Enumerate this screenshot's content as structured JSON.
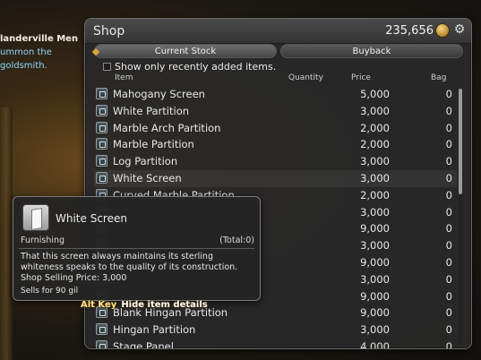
{
  "background": {
    "chat_line1": "landerville Men",
    "chat_line2": "ummon the goldsmith."
  },
  "shop": {
    "title": "Shop",
    "gil_amount": "235,656",
    "tabs": [
      {
        "label": "Current Stock",
        "active": true
      },
      {
        "label": "Buyback",
        "active": false
      }
    ],
    "filter_label": "Show only recently added items.",
    "filter_checked": false,
    "columns": {
      "item": "Item",
      "quantity": "Quantity",
      "price": "Price",
      "bag": "Bag"
    },
    "items": [
      {
        "name": "Mahogany Screen",
        "price": "5,000",
        "bag": "0"
      },
      {
        "name": "White Partition",
        "price": "3,000",
        "bag": "0"
      },
      {
        "name": "Marble Arch Partition",
        "price": "2,000",
        "bag": "0"
      },
      {
        "name": "Marble Partition",
        "price": "2,000",
        "bag": "0"
      },
      {
        "name": "Log Partition",
        "price": "3,000",
        "bag": "0"
      },
      {
        "name": "White Screen",
        "price": "3,000",
        "bag": "0",
        "highlighted": true
      },
      {
        "name": "Curved Marble Partition",
        "price": "2,000",
        "bag": "0"
      },
      {
        "name": "",
        "price": "3,000",
        "bag": "0"
      },
      {
        "name": "",
        "price": "9,000",
        "bag": "0"
      },
      {
        "name": "",
        "price": "3,000",
        "bag": "0"
      },
      {
        "name": "",
        "price": "9,000",
        "bag": "0"
      },
      {
        "name": "",
        "price": "3,000",
        "bag": "0"
      },
      {
        "name": "",
        "price": "9,000",
        "bag": "0"
      },
      {
        "name": "Blank Hingan Partition",
        "price": "9,000",
        "bag": "0"
      },
      {
        "name": "Hingan Partition",
        "price": "3,000",
        "bag": "0"
      },
      {
        "name": "Stage Panel",
        "price": "4,000",
        "bag": "0"
      }
    ]
  },
  "tooltip": {
    "item_name": "White Screen",
    "category": "Furnishing",
    "total": "(Total:0)",
    "description": "That this screen always maintains its sterling whiteness speaks to the quality of its construction.",
    "selling_price": "Shop Selling Price: 3,000",
    "sell_for": "Sells for 90 gil"
  },
  "hint": {
    "key": "Alt Key",
    "action": "Hide item details"
  },
  "icons": [
    "gil-coin-icon",
    "settings-icon",
    "item-icon",
    "screen-item-icon"
  ]
}
